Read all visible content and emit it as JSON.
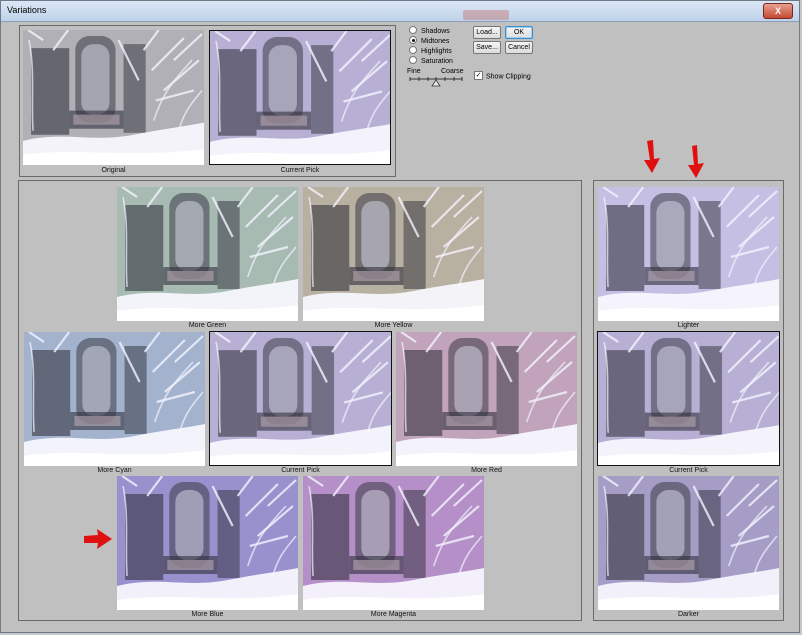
{
  "window": {
    "title": "Variations",
    "close_label": "X"
  },
  "adjust_options": [
    {
      "label": "Shadows",
      "selected": false
    },
    {
      "label": "Midtones",
      "selected": true
    },
    {
      "label": "Highlights",
      "selected": false
    },
    {
      "label": "Saturation",
      "selected": false
    }
  ],
  "buttons": {
    "load": "Load...",
    "ok": "OK",
    "save": "Save...",
    "cancel": "Cancel"
  },
  "slider": {
    "fine_label": "Fine",
    "coarse_label": "Coarse"
  },
  "show_clipping": {
    "label": "Show Clipping",
    "checked": true,
    "mark": "✓"
  },
  "preview": {
    "original": "Original",
    "current": "Current Pick"
  },
  "variations": {
    "more_green": "More Green",
    "more_yellow": "More Yellow",
    "more_cyan": "More Cyan",
    "current": "Current Pick",
    "more_red": "More Red",
    "more_blue": "More Blue",
    "more_magenta": "More Magenta"
  },
  "brightness": {
    "lighter": "Lighter",
    "current": "Current Pick",
    "darker": "Darker"
  },
  "tints": {
    "original": "#9a9aa2",
    "current": "#a59ac8",
    "green": "#8fa89e",
    "yellow": "#a49a86",
    "cyan": "#8a9ec0",
    "red": "#b08aa8",
    "blue": "#7d72c0",
    "magenta": "#a070b8",
    "lighter": "#b4aedc",
    "darker": "#8c82b6"
  },
  "annotation_arrow_color": "#e01010"
}
